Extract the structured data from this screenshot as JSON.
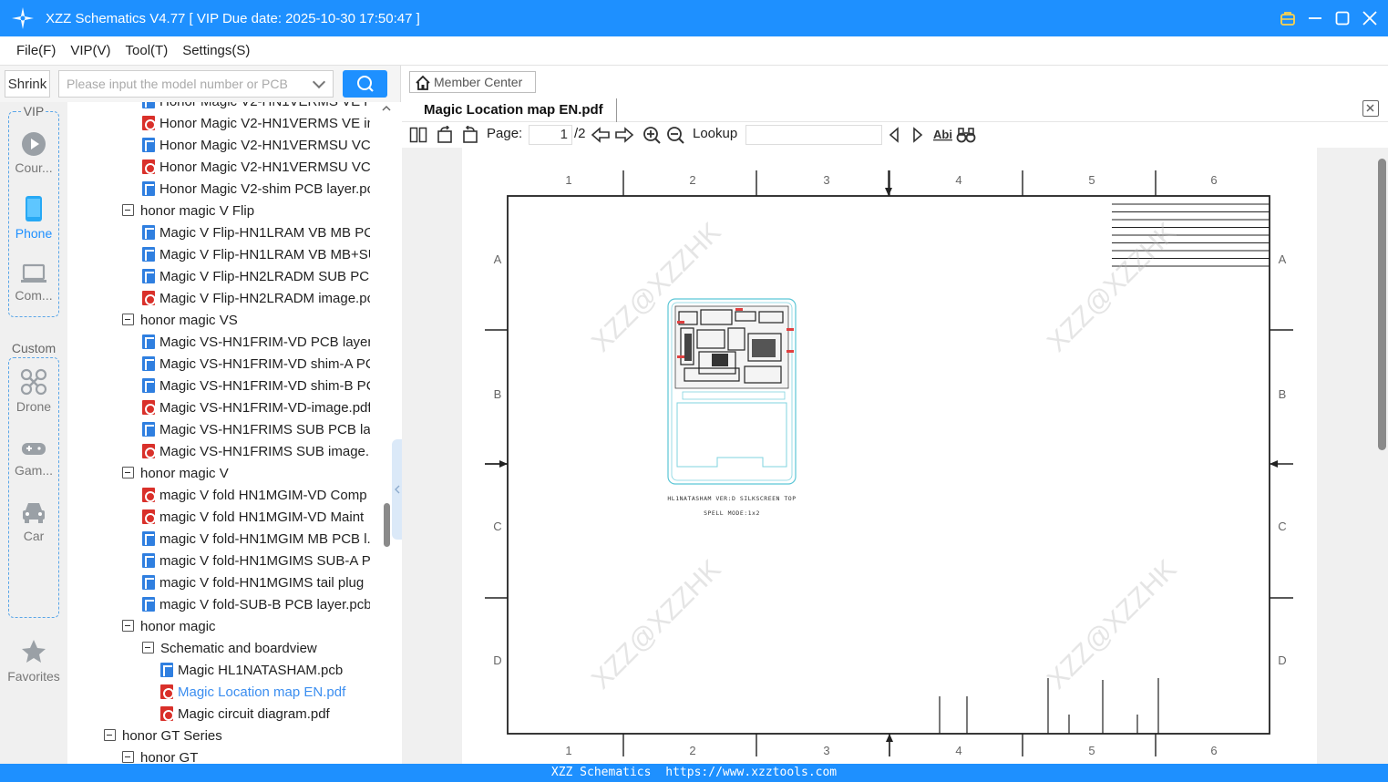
{
  "window": {
    "title": "XZZ Schematics V4.77 [ VIP Due date: 2025-10-30 17:50:47 ]",
    "accent": "#1e90ff"
  },
  "menu": [
    "File(F)",
    "VIP(V)",
    "Tool(T)",
    "Settings(S)"
  ],
  "search": {
    "shrink_label": "Shrink",
    "placeholder": "Please input the model number or PCB"
  },
  "rail": {
    "vip_label": "VIP",
    "custom_label": "Custom",
    "items": [
      {
        "label": "Cour...",
        "icon": "play-circle-icon"
      },
      {
        "label": "Phone",
        "icon": "phone-icon",
        "active": true
      },
      {
        "label": "Com...",
        "icon": "laptop-icon"
      },
      {
        "label": "Drone",
        "icon": "drone-icon"
      },
      {
        "label": "Gam...",
        "icon": "gamepad-icon"
      },
      {
        "label": "Car",
        "icon": "car-icon"
      },
      {
        "label": "Favorites",
        "icon": "star-icon"
      }
    ]
  },
  "tree": [
    {
      "type": "pcb",
      "indent": 2,
      "label": "Honor Magic V2-HN1VERMS VE PC"
    },
    {
      "type": "pdf",
      "indent": 2,
      "label": "Honor Magic V2-HN1VERMS VE im"
    },
    {
      "type": "pcb",
      "indent": 2,
      "label": "Honor Magic V2-HN1VERMSU VC"
    },
    {
      "type": "pdf",
      "indent": 2,
      "label": "Honor Magic V2-HN1VERMSU VC"
    },
    {
      "type": "pcb",
      "indent": 2,
      "label": "Honor Magic V2-shim PCB layer.pc"
    },
    {
      "type": "folder",
      "indent": 1,
      "label": "honor magic V Flip"
    },
    {
      "type": "pcb",
      "indent": 2,
      "label": "Magic V Flip-HN1LRAM VB MB PC"
    },
    {
      "type": "pcb",
      "indent": 2,
      "label": "Magic V Flip-HN1LRAM VB MB+SU"
    },
    {
      "type": "pcb",
      "indent": 2,
      "label": "Magic V Flip-HN2LRADM SUB PCB"
    },
    {
      "type": "pdf",
      "indent": 2,
      "label": "Magic V Flip-HN2LRADM image.pc"
    },
    {
      "type": "folder",
      "indent": 1,
      "label": "honor magic VS"
    },
    {
      "type": "pcb",
      "indent": 2,
      "label": "Magic VS-HN1FRIM-VD PCB layer.j"
    },
    {
      "type": "pcb",
      "indent": 2,
      "label": "Magic VS-HN1FRIM-VD shim-A PC"
    },
    {
      "type": "pcb",
      "indent": 2,
      "label": "Magic VS-HN1FRIM-VD shim-B PC"
    },
    {
      "type": "pdf",
      "indent": 2,
      "label": "Magic VS-HN1FRIM-VD-image.pdf"
    },
    {
      "type": "pcb",
      "indent": 2,
      "label": "Magic VS-HN1FRIMS SUB PCB laye"
    },
    {
      "type": "pdf",
      "indent": 2,
      "label": "Magic VS-HN1FRIMS SUB image.p"
    },
    {
      "type": "folder",
      "indent": 1,
      "label": "honor magic V"
    },
    {
      "type": "pdf",
      "indent": 2,
      "label": "magic V fold HN1MGIM-VD Comp"
    },
    {
      "type": "pdf",
      "indent": 2,
      "label": "magic V fold HN1MGIM-VD Maint"
    },
    {
      "type": "pcb",
      "indent": 2,
      "label": "magic V fold-HN1MGIM MB PCB l."
    },
    {
      "type": "pcb",
      "indent": 2,
      "label": "magic V fold-HN1MGIMS SUB-A P"
    },
    {
      "type": "pcb",
      "indent": 2,
      "label": "magic V fold-HN1MGIMS tail plug"
    },
    {
      "type": "pcb",
      "indent": 2,
      "label": "magic V fold-SUB-B PCB layer.pcb"
    },
    {
      "type": "folder",
      "indent": 1,
      "label": "honor magic"
    },
    {
      "type": "folder",
      "indent": 2,
      "label": "Schematic and boardview"
    },
    {
      "type": "pcb",
      "indent": 3,
      "label": "Magic HL1NATASHAM.pcb"
    },
    {
      "type": "pdf",
      "indent": 3,
      "label": "Magic Location map EN.pdf",
      "selected": true
    },
    {
      "type": "pdf",
      "indent": 3,
      "label": "Magic circuit diagram.pdf"
    },
    {
      "type": "folder",
      "indent": 0,
      "label": "honor GT Series"
    },
    {
      "type": "folder",
      "indent": 1,
      "label": "honor GT"
    }
  ],
  "viewer": {
    "member_center": "Member Center",
    "tab_title": "Magic Location map EN.pdf",
    "page_label": "Page:",
    "page_current": "1",
    "page_total": "/2",
    "lookup_label": "Lookup",
    "drawing": {
      "col_labels": [
        "1",
        "2",
        "3",
        "4",
        "5",
        "6"
      ],
      "row_labels": [
        "A",
        "B",
        "C",
        "D"
      ],
      "board_caption_1": "HL1NATASHAM VER:D SILKSCREEN TOP",
      "board_caption_2": "SPELL MODE:1x2",
      "watermark": "XZZ@XZZHK"
    }
  },
  "status": {
    "app": "XZZ Schematics",
    "url": "https://www.xzztools.com"
  }
}
